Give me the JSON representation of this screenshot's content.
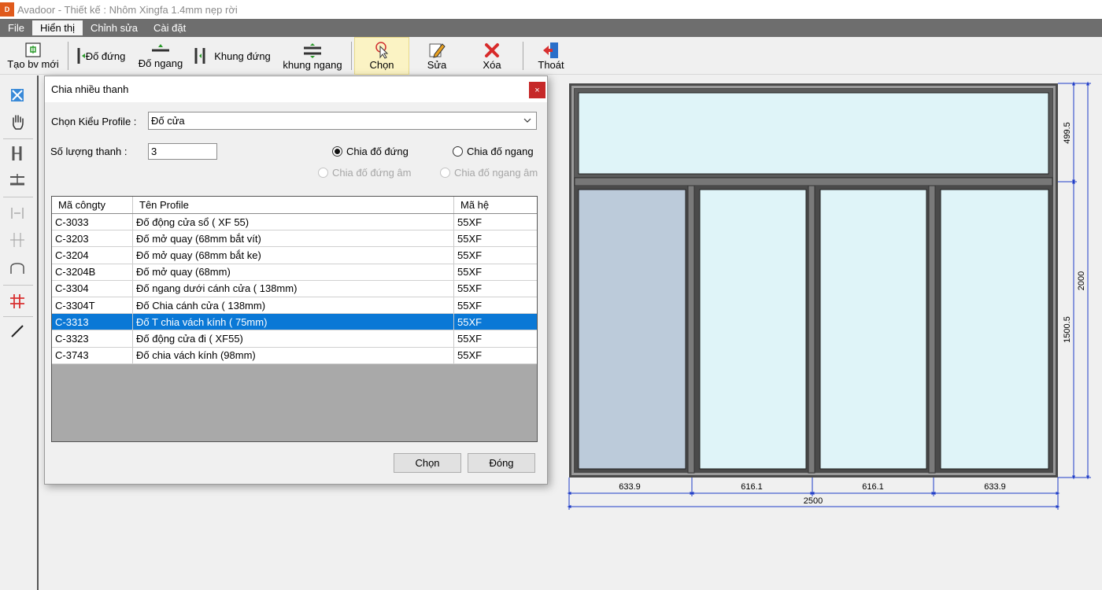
{
  "window": {
    "logo": "D",
    "title": "Avadoor - Thiết kế : Nhôm Xingfa 1.4mm nẹp rời"
  },
  "menu": [
    {
      "label": "File",
      "active": false
    },
    {
      "label": "Hiển thị",
      "active": true
    },
    {
      "label": "Chỉnh sửa",
      "active": false
    },
    {
      "label": "Cài đặt",
      "active": false
    }
  ],
  "toolbar": {
    "new_label": "Tạo bv mới",
    "vertical_mullion_label": "Đố đứng",
    "horizontal_mullion_label": "Đố ngang",
    "vertical_frame_label": "Khung đứng",
    "horizontal_frame_label": "khung ngang",
    "select_label": "Chọn",
    "edit_label": "Sửa",
    "delete_label": "Xóa",
    "exit_label": "Thoát"
  },
  "dialog": {
    "title": "Chia nhiều thanh",
    "close_glyph": "×",
    "profile_type_label": "Chọn Kiểu Profile :",
    "profile_type_value": "Đố cửa",
    "count_label": "Số lượng thanh :",
    "count_value": "3",
    "radio_vertical": "Chia đố đứng",
    "radio_horizontal": "Chia đố ngang",
    "radio_vertical_neg": "Chia đố đứng âm",
    "radio_horizontal_neg": "Chia đố ngang âm",
    "table": {
      "headers": [
        "Mã côngty",
        "Tên Profile",
        "Mã hệ"
      ],
      "rows": [
        [
          "C-3033",
          "Đố động cửa sổ ( XF 55)",
          "55XF"
        ],
        [
          "C-3203",
          "Đố mở quay (68mm bắt vít)",
          "55XF"
        ],
        [
          "C-3204",
          "Đố mở quay (68mm bắt ke)",
          "55XF"
        ],
        [
          "C-3204B",
          "Đố mở quay (68mm)",
          "55XF"
        ],
        [
          "C-3304",
          "Đố ngang dưới cánh cửa ( 138mm)",
          "55XF"
        ],
        [
          "C-3304T",
          "Đố Chia cánh cửa ( 138mm)",
          "55XF"
        ],
        [
          "C-3313",
          "Đố T chia vách kính ( 75mm)",
          "55XF"
        ],
        [
          "C-3323",
          "Đố động cửa đi  ( XF55)",
          "55XF"
        ],
        [
          "C-3743",
          "Đố chia vách kính (98mm)",
          "55XF"
        ]
      ],
      "selected_row": 6
    },
    "ok_label": "Chọn",
    "close_label": "Đóng"
  },
  "drawing": {
    "widths": [
      "633.9",
      "616.1",
      "616.1",
      "633.9"
    ],
    "total_width": "2500",
    "heights": [
      "499.5",
      "1500.5"
    ],
    "total_height": "2000"
  },
  "colors": {
    "frame": "#4a4a4a",
    "glass": "#dff4f8",
    "glass_selected": "#bccbda",
    "dimension": "#1e3cc8",
    "selection": "#0a78d6"
  }
}
